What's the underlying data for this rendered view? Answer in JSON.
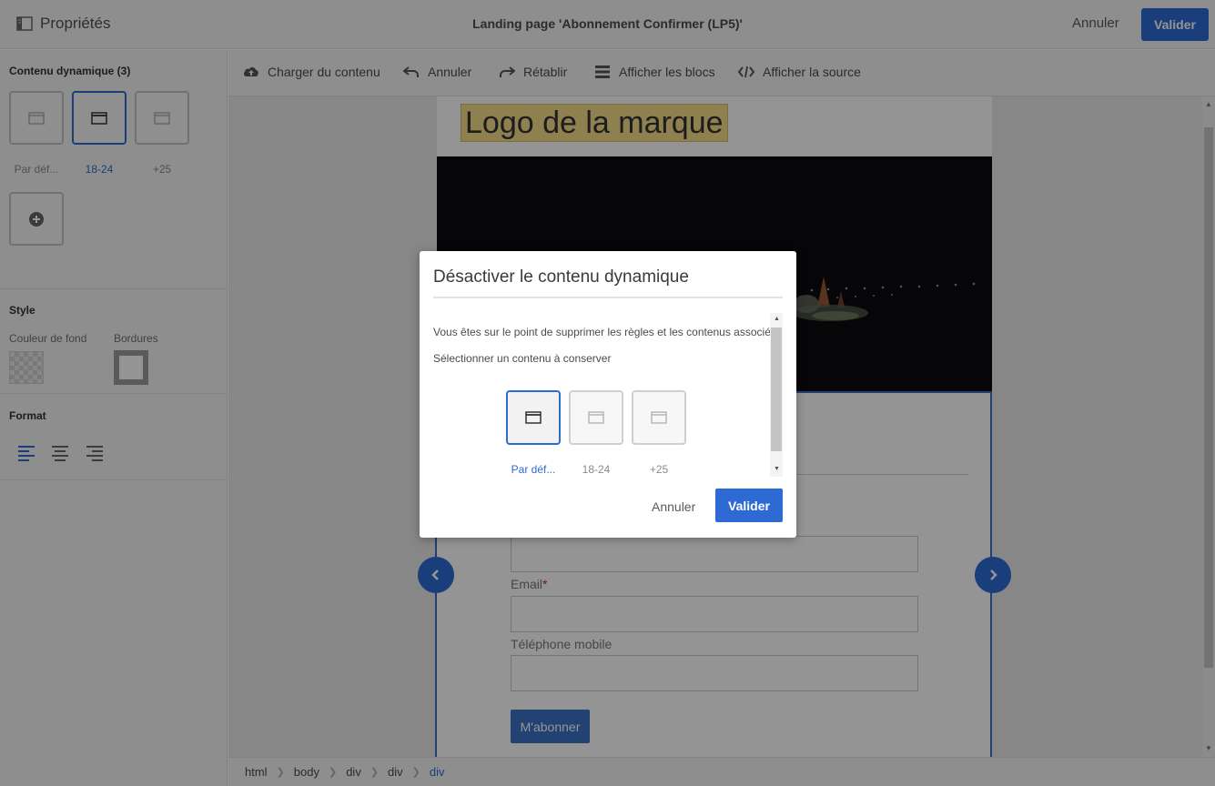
{
  "header": {
    "properties_label": "Propriétés",
    "title": "Landing page 'Abonnement Confirmer (LP5)'",
    "cancel_label": "Annuler",
    "validate_label": "Valider"
  },
  "sidebar": {
    "dynamic_content_title": "Contenu dynamique (3)",
    "variants": [
      {
        "label": "Par déf...",
        "selected": false
      },
      {
        "label": "18-24",
        "selected": true
      },
      {
        "label": "+25",
        "selected": false
      }
    ],
    "style_title": "Style",
    "bg_color_label": "Couleur de fond",
    "borders_label": "Bordures",
    "format_title": "Format"
  },
  "toolbar": {
    "load_content": "Charger du contenu",
    "undo": "Annuler",
    "redo": "Rétablir",
    "show_blocks": "Afficher les blocs",
    "show_source": "Afficher la source"
  },
  "page": {
    "logo_text": "Logo de la marque",
    "email_label": "Email",
    "required_mark": "*",
    "mobile_label": "Téléphone mobile",
    "subscribe_label": "M'abonner"
  },
  "breadcrumb": [
    "html",
    "body",
    "div",
    "div",
    "div"
  ],
  "modal": {
    "title": "Désactiver le contenu dynamique",
    "warning": "Vous êtes sur le point de supprimer les règles et les contenus associés.",
    "select_text": "Sélectionner un contenu à conserver",
    "variants": [
      {
        "label": "Par déf...",
        "selected": true
      },
      {
        "label": "18-24",
        "selected": false
      },
      {
        "label": "+25",
        "selected": false
      }
    ],
    "cancel_label": "Annuler",
    "validate_label": "Valider"
  },
  "colors": {
    "accent": "#2d6ad4",
    "logo_bg": "#f6dc8a",
    "required": "#c4272c"
  }
}
